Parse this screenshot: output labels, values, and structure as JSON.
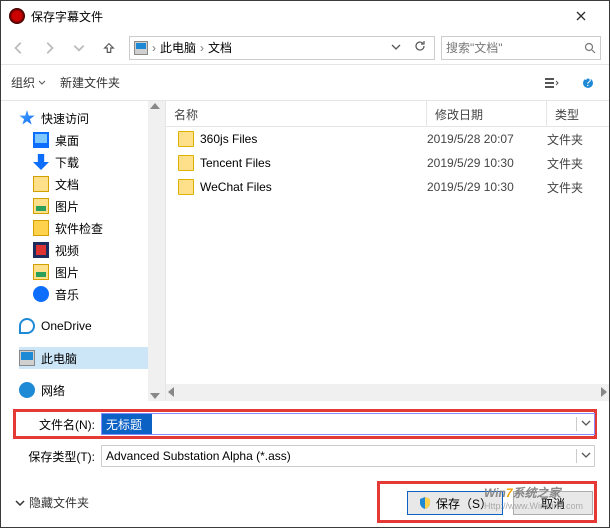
{
  "window": {
    "title": "保存字幕文件"
  },
  "nav": {
    "path_root_icon": "pc-icon",
    "segments": [
      "此电脑",
      "文档"
    ],
    "search_placeholder": "搜索\"文档\""
  },
  "toolbar": {
    "organize": "组织",
    "new_folder": "新建文件夹"
  },
  "tree": {
    "quick_access": "快速访问",
    "desktop": "桌面",
    "downloads": "下载",
    "documents": "文档",
    "pictures": "图片",
    "software_check": "软件检查",
    "videos": "视频",
    "pictures2": "图片",
    "music": "音乐",
    "onedrive": "OneDrive",
    "this_pc": "此电脑",
    "network": "网络"
  },
  "columns": {
    "name": "名称",
    "date": "修改日期",
    "type": "类型"
  },
  "files": [
    {
      "name": "360js Files",
      "date": "2019/5/28 20:07",
      "type": "文件夹"
    },
    {
      "name": "Tencent Files",
      "date": "2019/5/29 10:30",
      "type": "文件夹"
    },
    {
      "name": "WeChat Files",
      "date": "2019/5/29 10:30",
      "type": "文件夹"
    }
  ],
  "form": {
    "filename_label": "文件名(N):",
    "filename_value": "无标题",
    "filetype_label": "保存类型(T):",
    "filetype_value": "Advanced Substation Alpha (*.ass)"
  },
  "footer": {
    "hide_folders": "隐藏文件夹",
    "save": "保存（S）",
    "cancel": "取消"
  },
  "watermark": {
    "brand_prefix": "Win",
    "brand_accent": "7",
    "brand_suffix": "系统之家",
    "url": "Http://www.Winwin7.com"
  }
}
